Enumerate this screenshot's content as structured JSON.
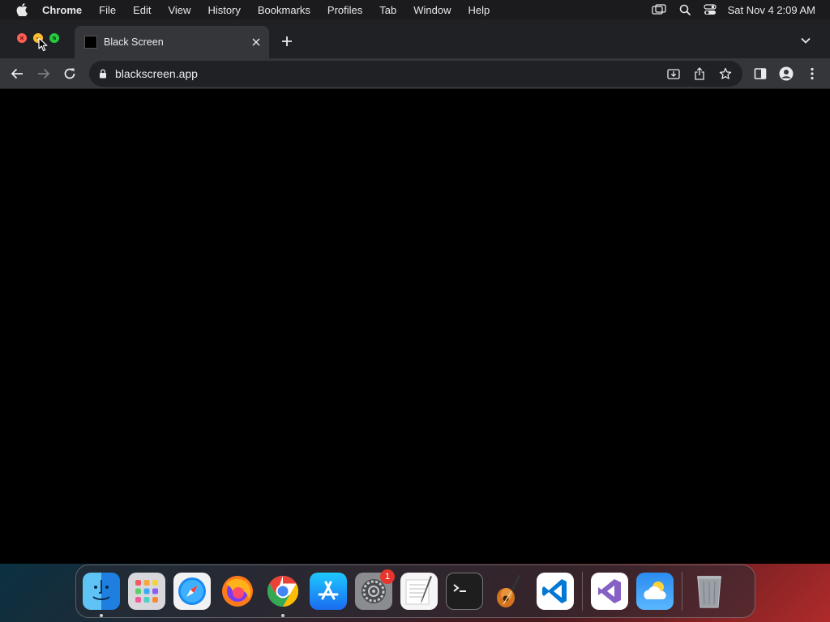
{
  "menubar": {
    "app_name": "Chrome",
    "items": [
      "File",
      "Edit",
      "View",
      "History",
      "Bookmarks",
      "Profiles",
      "Tab",
      "Window",
      "Help"
    ],
    "clock": "Sat Nov 4  2:09 AM"
  },
  "browser": {
    "tab_title": "Black Screen",
    "url": "blackscreen.app"
  },
  "dock": {
    "apps": [
      "Finder",
      "Launchpad",
      "Safari",
      "Firefox",
      "Chrome",
      "App Store",
      "System Settings",
      "TextEdit",
      "Terminal",
      "GarageBand",
      "Visual Studio Code",
      "Visual Studio",
      "Weather",
      "Trash"
    ],
    "settings_badge": "1"
  },
  "colors": {
    "tab_bg": "#202124",
    "toolbar_bg": "#35363a",
    "page_bg": "#000000",
    "close": "#ff5f57",
    "minimize": "#febc2e",
    "zoom": "#28c840"
  }
}
